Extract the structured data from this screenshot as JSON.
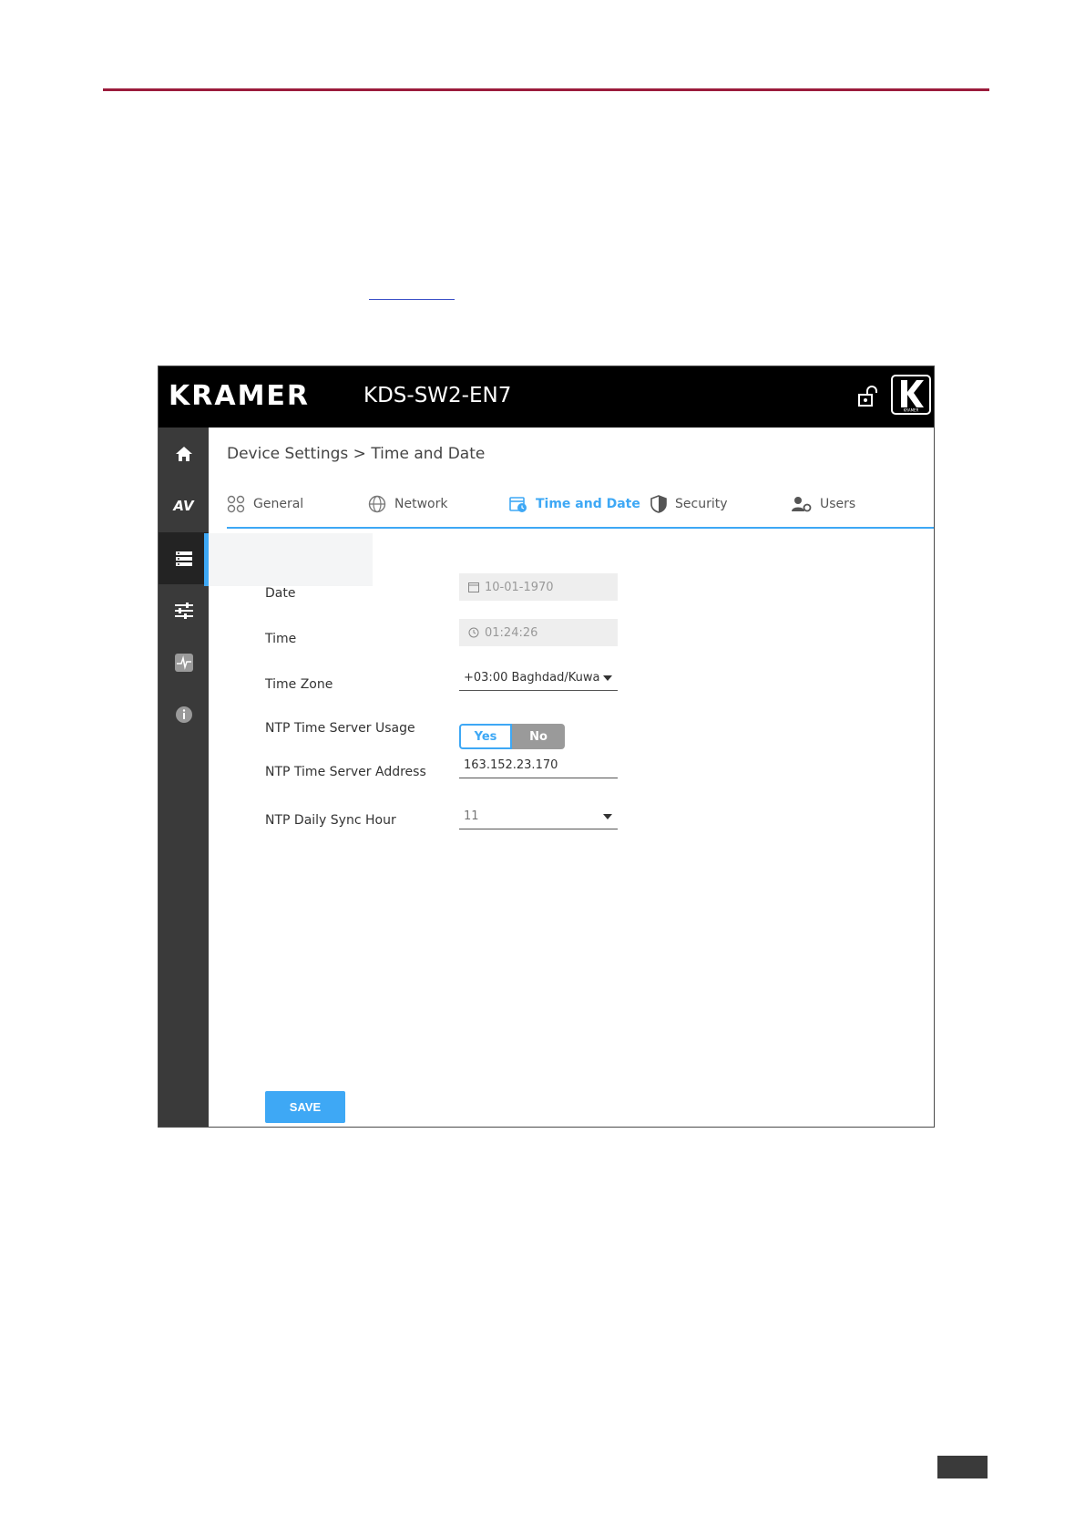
{
  "app": {
    "brand": "KRAMER",
    "device_name": "KDS-SW2-EN7",
    "logo_text": "KRAMER",
    "sidebar": {
      "items": [
        {
          "id": "home",
          "icon": "home-icon"
        },
        {
          "id": "av",
          "label": "AV",
          "icon": "av-icon"
        },
        {
          "id": "device-settings",
          "icon": "device-settings-icon",
          "active": true
        },
        {
          "id": "adjust",
          "icon": "sliders-icon"
        },
        {
          "id": "diagnostics",
          "icon": "pulse-icon"
        },
        {
          "id": "about",
          "icon": "info-icon"
        }
      ]
    },
    "breadcrumb": "Device Settings > Time and Date",
    "tabs": [
      {
        "label": "General",
        "icon": "general-icon"
      },
      {
        "label": "Network",
        "icon": "globe-icon"
      },
      {
        "label": "Time and Date",
        "icon": "calendar-clock-icon",
        "active": true
      },
      {
        "label": "Security",
        "icon": "shield-icon"
      },
      {
        "label": "Users",
        "icon": "users-gear-icon"
      }
    ],
    "form": {
      "date": {
        "label": "Date",
        "value": "10-01-1970"
      },
      "time": {
        "label": "Time",
        "value": "01:24:26"
      },
      "time_zone": {
        "label": "Time Zone",
        "value": "+03:00 Baghdad/Kuwa"
      },
      "ntp_usage": {
        "label": "NTP Time Server Usage",
        "yes": "Yes",
        "no": "No",
        "selected": "Yes"
      },
      "ntp_address": {
        "label": "NTP Time Server Address",
        "value": "163.152.23.170"
      },
      "ntp_sync_hour": {
        "label": "NTP Daily Sync Hour",
        "value": "11"
      }
    },
    "save_label": "SAVE",
    "colors": {
      "accent": "#3ea8f5",
      "header": "#000000",
      "sidebar": "#3a3a3a",
      "rule": "#9b1c3c"
    }
  }
}
